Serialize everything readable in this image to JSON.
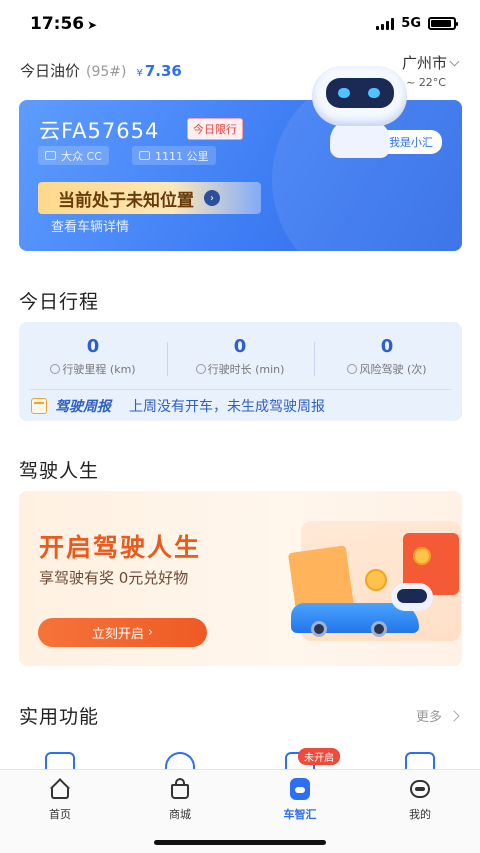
{
  "status_bar": {
    "time": "17:56",
    "network": "5G",
    "signal_level": 4,
    "battery_percent": 90
  },
  "header": {
    "oil_label": "今日油价",
    "oil_grade": "(95#)",
    "currency": "¥",
    "oil_price": "7.36",
    "city": "广州市",
    "weather": "阴  13 ~ 22°C"
  },
  "car_card": {
    "plate": "云FA57654",
    "limit_tag": "今日限行",
    "brand": "大众 CC",
    "mileage": "1111 公里",
    "location_status": "当前处于未知位置",
    "detail_link": "查看车辆详情",
    "assistant_greeting": "Hi,我是小汇"
  },
  "trip": {
    "section_title": "今日行程",
    "stats": [
      {
        "value": "0",
        "label": "行驶里程 (km)"
      },
      {
        "value": "0",
        "label": "行驶时长 (min)"
      },
      {
        "value": "0",
        "label": "风险驾驶 (次)"
      }
    ],
    "report_title": "驾驶周报",
    "report_message": "上周没有开车，未生成驾驶周报"
  },
  "drive_life": {
    "section_title": "驾驶人生",
    "title": "开启驾驶人生",
    "subtitle": "享驾驶有奖  0元兑好物",
    "button": "立刻开启"
  },
  "utilities": {
    "section_title": "实用功能",
    "more": "更多",
    "badge": "未开启"
  },
  "tabs": [
    {
      "label": "首页",
      "icon": "home-icon",
      "active": false
    },
    {
      "label": "商城",
      "icon": "shopping-bag-icon",
      "active": false
    },
    {
      "label": "车智汇",
      "icon": "car-smart-icon",
      "active": true
    },
    {
      "label": "我的",
      "icon": "profile-icon",
      "active": false
    }
  ],
  "colors": {
    "accent": "#2c6ff2",
    "warning": "#ea5a1c",
    "alert": "#e94646"
  }
}
